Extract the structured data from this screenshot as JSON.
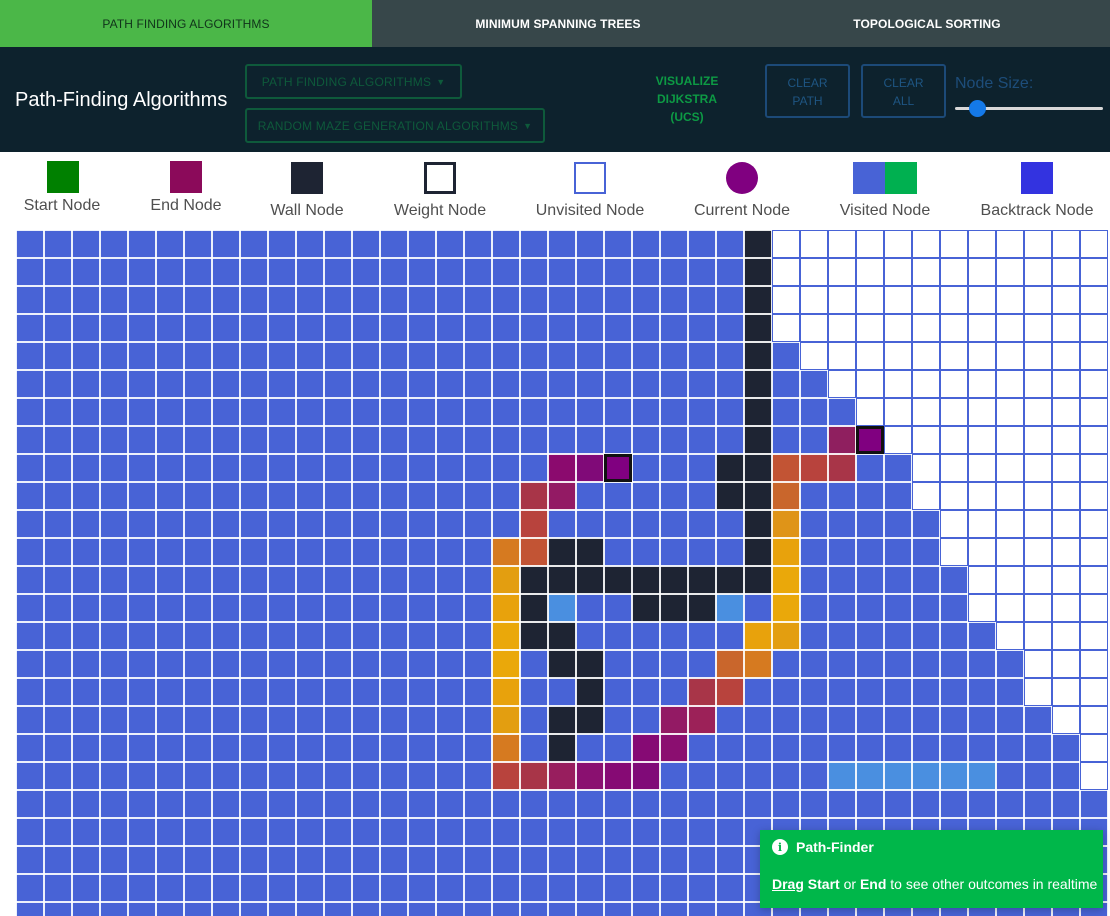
{
  "tabs": [
    {
      "label": "PATH FINDING ALGORITHMS",
      "active": true
    },
    {
      "label": "MINIMUM SPANNING TREES",
      "active": false
    },
    {
      "label": "TOPOLOGICAL SORTING",
      "active": false
    }
  ],
  "navbar": {
    "brand": "Path-Finding Algorithms",
    "path_dropdown": "PATH FINDING ALGORITHMS",
    "maze_dropdown": "RANDOM MAZE GENERATION ALGORITHMS",
    "visualize_line1": "VISUALIZE",
    "visualize_line2": "DIJKSTRA",
    "visualize_line3": "(UCS)",
    "clear_path_line1": "CLEAR",
    "clear_path_line2": "PATH",
    "clear_all_line1": "CLEAR",
    "clear_all_line2": "ALL",
    "node_size_label": "Node Size:",
    "node_size_value": 0.15
  },
  "legend": [
    {
      "label": "Start Node",
      "color": "#008000"
    },
    {
      "label": "End Node",
      "color": "#8b0a5a"
    },
    {
      "label": "Wall Node",
      "color": "#1e2433"
    },
    {
      "label": "Weight Node",
      "color": "#ffffff"
    },
    {
      "label": "Unvisited Node",
      "color": "#ffffff"
    },
    {
      "label": "Current Node",
      "color": "#800080"
    },
    {
      "label": "Visited Node",
      "colors": [
        "#4863d6",
        "#00b050"
      ]
    },
    {
      "label": "Backtrack Node",
      "color": "#3333e0"
    }
  ],
  "colors": {
    "visited": "#4863d6",
    "unvisited": "#ffffff",
    "wall": "#1e2433",
    "current": "#800080",
    "frontier": "#4a8fe0",
    "tab_active": "#4bb748",
    "toast": "#00b74a"
  },
  "toast": {
    "title": "Path-Finder",
    "drag": "Drag",
    "start": "Start",
    "or": "or",
    "end": "End",
    "rest": "to see other outcomes in realtime"
  }
}
